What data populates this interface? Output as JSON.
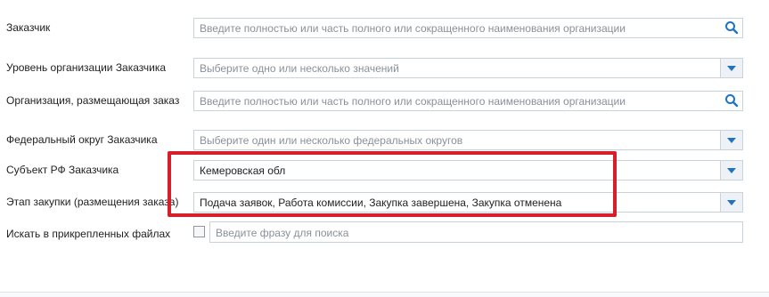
{
  "form": {
    "customer": {
      "label": "Заказчик",
      "placeholder": "Введите полностью или часть полного или сокращенного наименования организации"
    },
    "org_level": {
      "label": "Уровень организации Заказчика",
      "placeholder": "Выберите одно или несколько значений"
    },
    "placing_org": {
      "label": "Организация, размещающая заказ",
      "placeholder": "Введите полностью или часть полного или сокращенного наименования организации"
    },
    "federal_district": {
      "label": "Федеральный округ Заказчика",
      "placeholder": "Выберите один или несколько федеральных округов"
    },
    "region": {
      "label": "Субъект РФ Заказчика",
      "value": "Кемеровская обл"
    },
    "stage": {
      "label": "Этап закупки (размещения заказа)",
      "value": "Подача заявок, Работа комиссии, Закупка завершена, Закупка отменена"
    },
    "attached_files": {
      "label": "Искать в прикрепленных файлах",
      "placeholder": "Введите фразу для поиска",
      "checked": false
    }
  },
  "icons": {
    "search": "search-icon",
    "dropdown": "triangle-down-icon"
  },
  "colors": {
    "accent": "#1f74c1",
    "highlight": "#d61f2b",
    "border": "#c9d3dc"
  }
}
